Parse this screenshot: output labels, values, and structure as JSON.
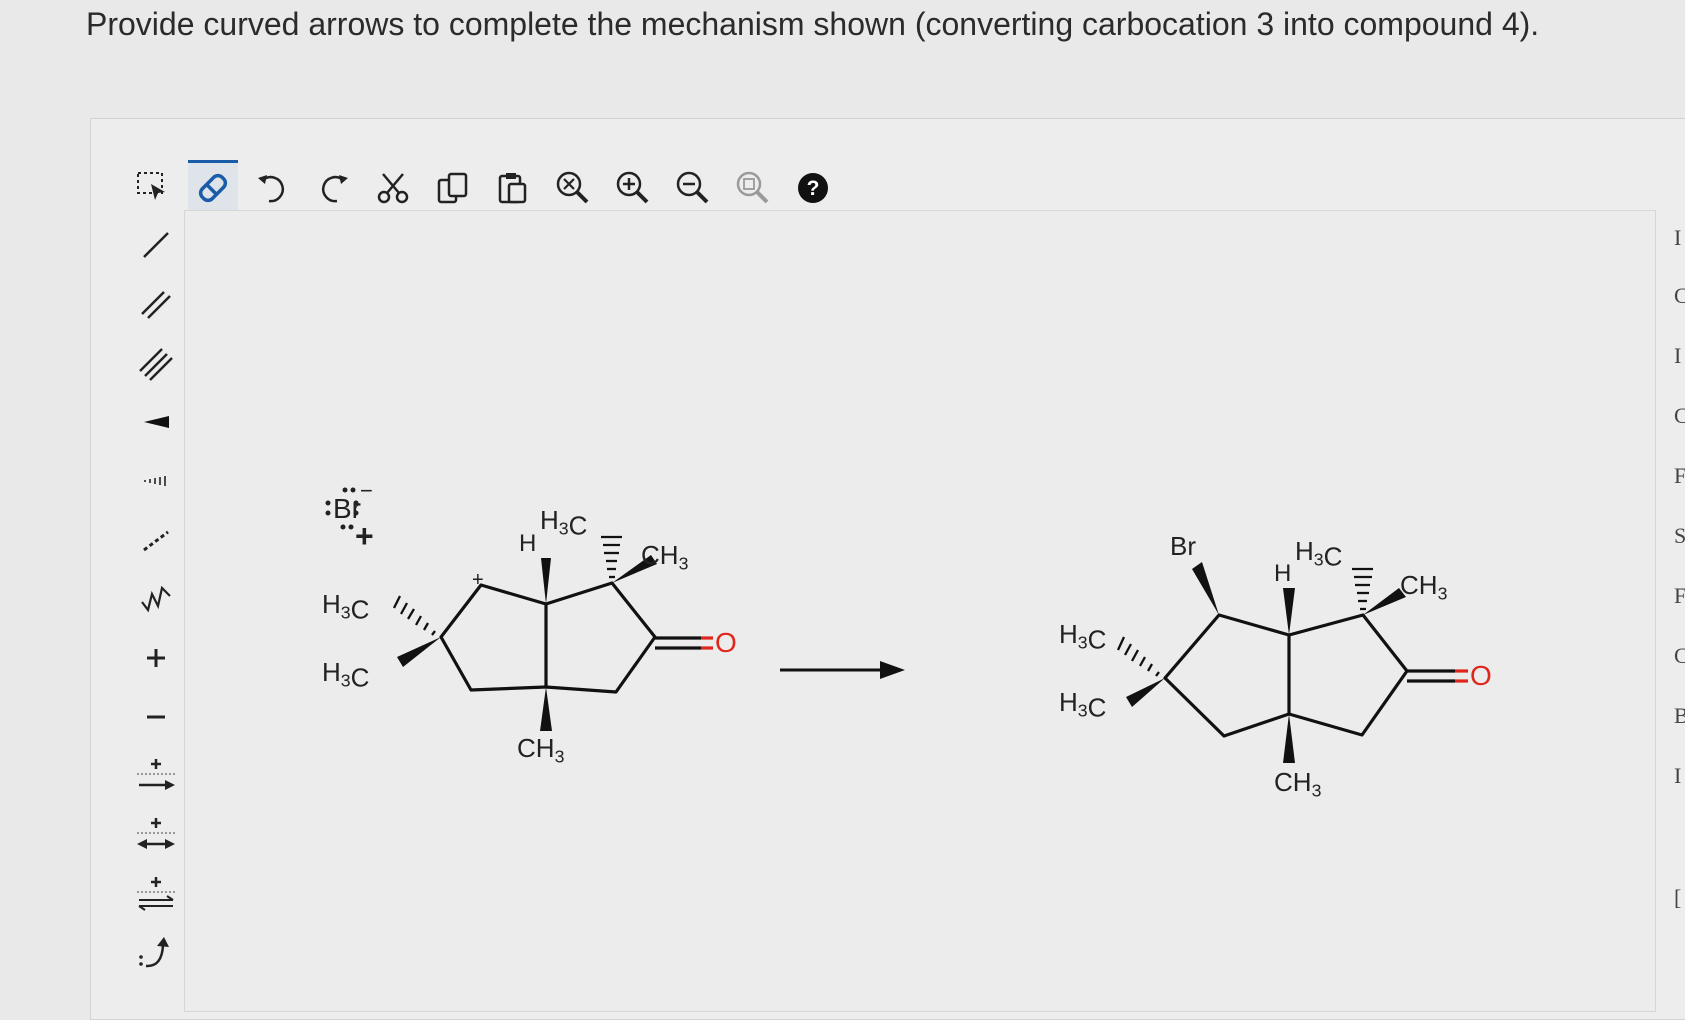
{
  "question": "Provide curved arrows to complete the mechanism shown (converting carbocation 3 into compound 4).",
  "toolbar": [
    {
      "name": "select-tool",
      "icon": "marquee-select-icon"
    },
    {
      "name": "erase-tool",
      "icon": "eraser-icon",
      "active": true
    },
    {
      "name": "undo",
      "icon": "undo-icon"
    },
    {
      "name": "redo",
      "icon": "redo-icon"
    },
    {
      "name": "cut",
      "icon": "scissors-icon"
    },
    {
      "name": "copy",
      "icon": "copy-icon"
    },
    {
      "name": "paste",
      "icon": "paste-icon"
    },
    {
      "name": "zoom-fit",
      "icon": "zoom-fit-icon"
    },
    {
      "name": "zoom-in",
      "icon": "zoom-in-icon"
    },
    {
      "name": "zoom-out",
      "icon": "zoom-out-icon"
    },
    {
      "name": "zoom-reset",
      "icon": "zoom-reset-icon"
    },
    {
      "name": "help",
      "icon": "help-icon"
    }
  ],
  "sidebar": [
    {
      "name": "single-bond-tool",
      "icon": "single-bond-icon"
    },
    {
      "name": "double-bond-tool",
      "icon": "double-bond-icon"
    },
    {
      "name": "triple-bond-tool",
      "icon": "triple-bond-icon"
    },
    {
      "name": "wedge-bond-tool",
      "icon": "wedge-bond-icon"
    },
    {
      "name": "hash-bond-tool",
      "icon": "hash-bond-icon"
    },
    {
      "name": "dashed-bond-tool",
      "icon": "dashed-bond-icon"
    },
    {
      "name": "chain-tool",
      "icon": "chain-icon"
    },
    {
      "name": "positive-charge-tool",
      "icon": "plus-icon"
    },
    {
      "name": "negative-charge-tool",
      "icon": "minus-icon"
    },
    {
      "name": "reaction-arrow-tool",
      "icon": "reaction-arrow-icon"
    },
    {
      "name": "resonance-arrow-tool",
      "icon": "resonance-arrow-icon"
    },
    {
      "name": "equilibrium-arrow-tool",
      "icon": "equilibrium-arrow-icon"
    },
    {
      "name": "curved-arrow-tool",
      "icon": "curved-arrow-icon"
    }
  ],
  "molecules": {
    "reagent": {
      "atom": "Br",
      "charge": "−",
      "plus": "+"
    },
    "carbocation": {
      "h_label": "H",
      "methyl_top": "H3C",
      "methyl_right": "CH3",
      "methyl_left_hash": "H3C",
      "methyl_left_wedge": "H3C",
      "methyl_bottom": "CH3",
      "oxygen": "O",
      "cation": "+"
    },
    "product": {
      "bromine": "Br",
      "h_label": "H",
      "methyl_top": "H3C",
      "methyl_right": "CH3",
      "methyl_left_hash": "H3C",
      "methyl_left_wedge": "H3C",
      "methyl_bottom": "CH3",
      "oxygen": "O"
    }
  },
  "colors": {
    "oxygen": "#e0261c",
    "bond": "#111111",
    "accent": "#1a5ca8"
  },
  "right_strip_letters": [
    "I",
    "C",
    "I",
    "C",
    "F",
    "S",
    "F",
    "C",
    "B",
    "I",
    "["
  ]
}
